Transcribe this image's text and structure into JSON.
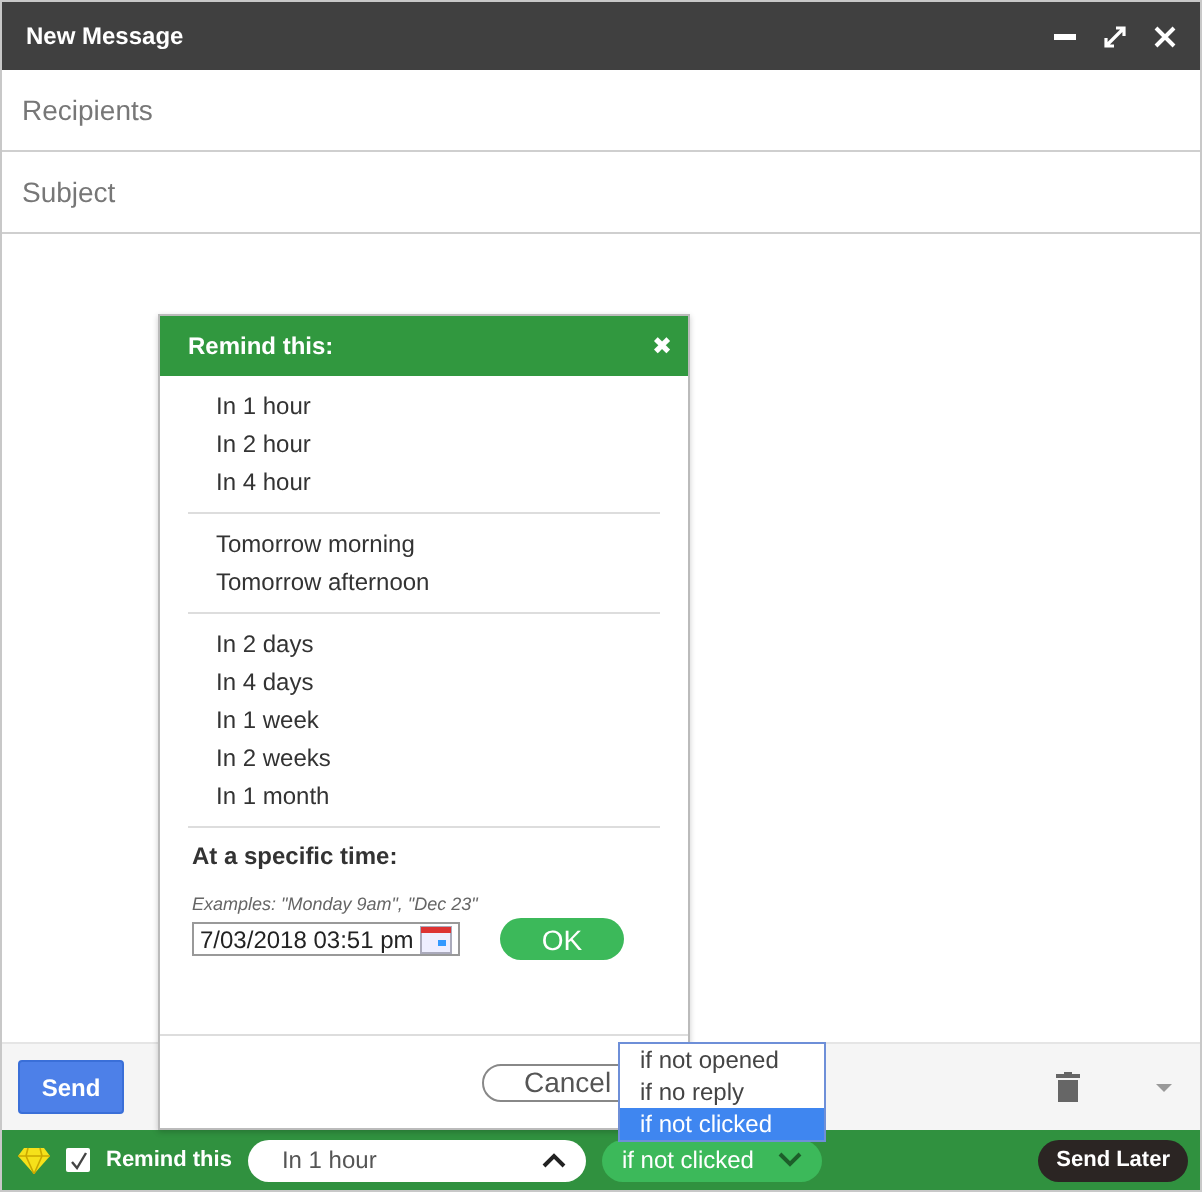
{
  "window": {
    "title": "New Message"
  },
  "fields": [
    {
      "placeholder": "Recipients"
    },
    {
      "placeholder": "Subject"
    }
  ],
  "reminder_popup": {
    "title": "Remind this:",
    "close": "✖",
    "groups": [
      [
        "In 1 hour",
        "In 2 hour",
        "In 4 hour"
      ],
      [
        "Tomorrow morning",
        "Tomorrow afternoon"
      ],
      [
        "In 2 days",
        "In 4 days",
        "In 1 week",
        "In 2 weeks",
        "In 1 month"
      ]
    ],
    "specific_time": {
      "label": "At a specific time:",
      "examples": "Examples: \"Monday 9am\", \"Dec 23\"",
      "value": "7/03/2018 03:51 pm",
      "ok": "OK"
    },
    "cancel": "Cancel"
  },
  "condition_menu": [
    {
      "label": "if not opened",
      "selected": false
    },
    {
      "label": "if no reply",
      "selected": false
    },
    {
      "label": "if not clicked",
      "selected": true
    }
  ],
  "toolbar": {
    "send": "Send"
  },
  "reminder_bar": {
    "checked": true,
    "label": "Remind this",
    "time": "In 1 hour",
    "condition": "if not clicked",
    "send_later": "Send Later"
  }
}
